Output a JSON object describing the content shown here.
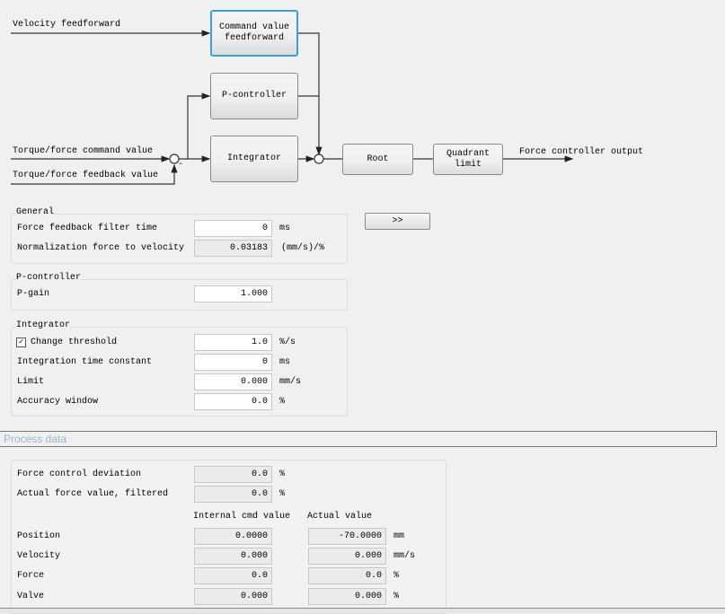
{
  "diagram": {
    "velocity_ff": "Velocity feedforward",
    "torque_cmd": "Torque/force command value",
    "torque_fb": "Torque/force feedback value",
    "minus": "-",
    "blocks": {
      "cvf": "Command value feedforward",
      "p": "P-controller",
      "i": "Integrator",
      "root": "Root",
      "quadrant": "Quadrant limit"
    },
    "output": "Force controller output"
  },
  "expand_button": ">>",
  "general": {
    "title": "General",
    "rows": [
      {
        "label": "Force feedback filter time",
        "value": "0",
        "unit": "ms"
      },
      {
        "label": "Normalization force to velocity",
        "value": "0.03183",
        "unit": "(mm/s)/%"
      }
    ]
  },
  "pctrl": {
    "title": "P-controller",
    "rows": [
      {
        "label": "P-gain",
        "value": "1.000",
        "unit": ""
      }
    ]
  },
  "integrator": {
    "title": "Integrator",
    "checkbox_label": "Change threshold",
    "checked": true,
    "rows": [
      {
        "label": "Change threshold",
        "value": "1.0",
        "unit": "%/s"
      },
      {
        "label": "Integration time constant",
        "value": "0",
        "unit": "ms"
      },
      {
        "label": "Limit",
        "value": "0.000",
        "unit": "mm/s"
      },
      {
        "label": "Accuracy window",
        "value": "0.0",
        "unit": "%"
      }
    ]
  },
  "process": {
    "title": "Process data",
    "rows": [
      {
        "label": "Force control deviation",
        "value": "0.0",
        "unit": "%"
      },
      {
        "label": "Actual force value, filtered",
        "value": "0.0",
        "unit": "%"
      }
    ],
    "col_internal": "Internal cmd value",
    "col_actual": "Actual value",
    "table": [
      {
        "label": "Position",
        "internal": "0.0000",
        "actual": "-70.0000",
        "unit": "mm"
      },
      {
        "label": "Velocity",
        "internal": "0.000",
        "actual": "0.000",
        "unit": "mm/s"
      },
      {
        "label": "Force",
        "internal": "0.0",
        "actual": "0.0",
        "unit": "%"
      },
      {
        "label": "Valve",
        "internal": "0.000",
        "actual": "0.000",
        "unit": "%"
      }
    ]
  }
}
